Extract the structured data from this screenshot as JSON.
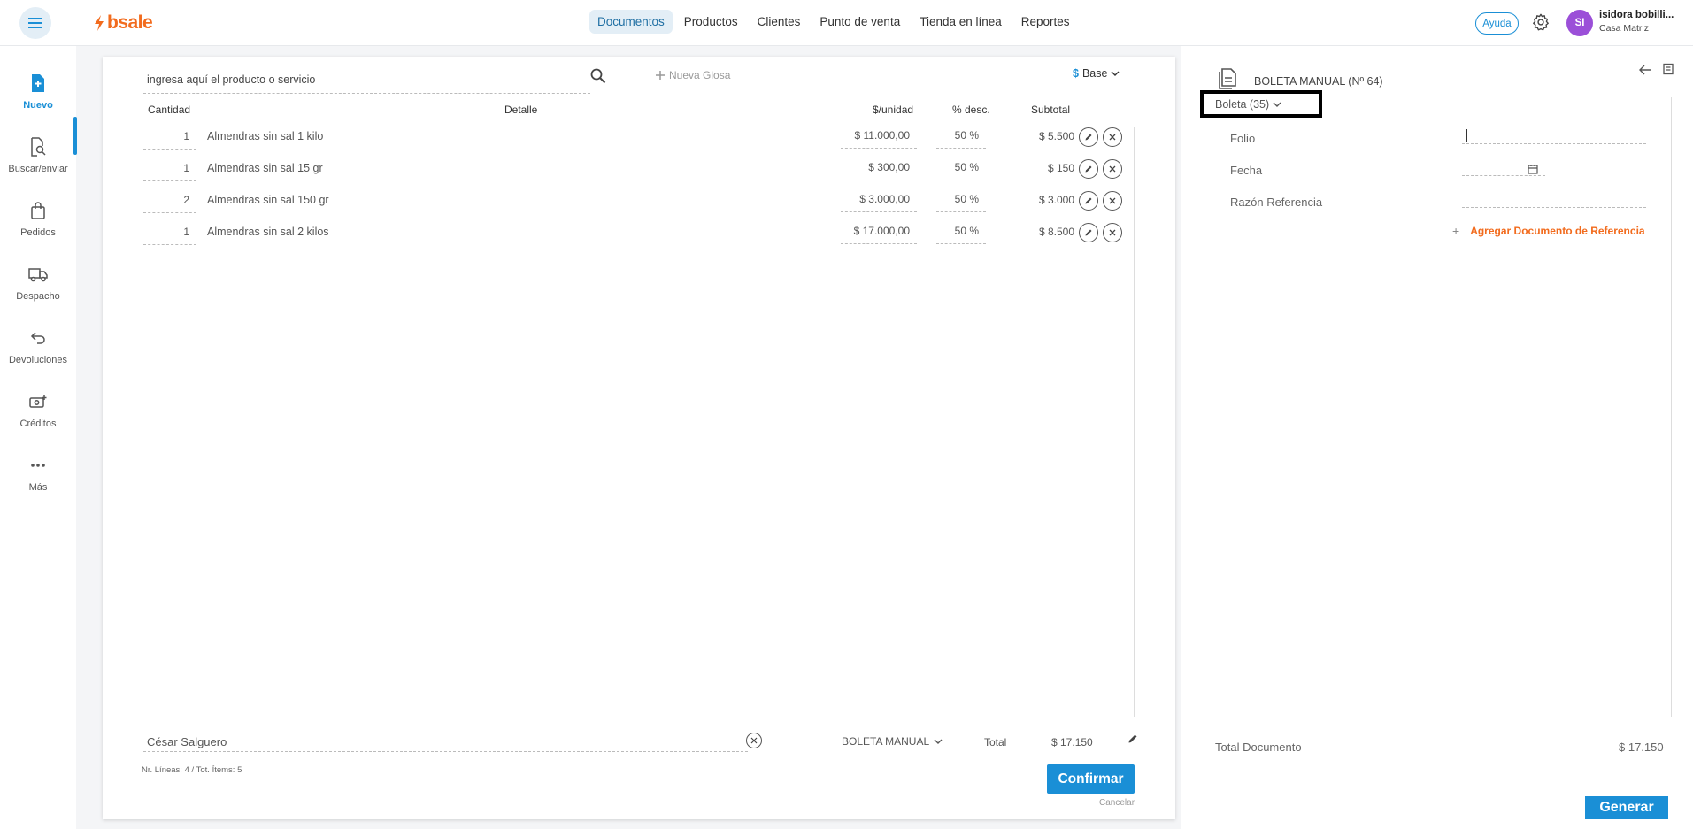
{
  "topbar": {
    "logo_text": "bsale",
    "nav": [
      "Documentos",
      "Productos",
      "Clientes",
      "Punto de venta",
      "Tienda en línea",
      "Reportes"
    ],
    "help_label": "Ayuda",
    "avatar_initials": "SI",
    "user_name": "isidora bobilli...",
    "user_store": "Casa Matriz",
    "accent_color": "#1a8fd6",
    "brand_color": "#f26b1d"
  },
  "sidebar": {
    "items": [
      {
        "label": "Nuevo",
        "icon": "new-document-icon"
      },
      {
        "label": "Buscar/enviar",
        "icon": "search-document-icon"
      },
      {
        "label": "Pedidos",
        "icon": "shopping-bag-icon"
      },
      {
        "label": "Despacho",
        "icon": "truck-icon"
      },
      {
        "label": "Devoluciones",
        "icon": "return-icon"
      },
      {
        "label": "Créditos",
        "icon": "credit-icon"
      },
      {
        "label": "Más",
        "icon": "more-icon"
      }
    ]
  },
  "editor": {
    "search_placeholder": "ingresa aquí el producto o servicio",
    "new_glosa_label": "Nueva Glosa",
    "currency_symbol": "$",
    "price_list": "Base",
    "headers": {
      "qty": "Cantidad",
      "detail": "Detalle",
      "unit_price": "$/unidad",
      "discount": "% desc.",
      "subtotal": "Subtotal"
    },
    "lines": [
      {
        "qty": "1",
        "detail": "Almendras sin sal 1 kilo",
        "price": "$ 11.000,00",
        "discount": "50 %",
        "subtotal": "$ 5.500"
      },
      {
        "qty": "1",
        "detail": "Almendras sin sal 15 gr",
        "price": "$ 300,00",
        "discount": "50 %",
        "subtotal": "$ 150"
      },
      {
        "qty": "2",
        "detail": "Almendras sin sal 150 gr",
        "price": "$ 3.000,00",
        "discount": "50 %",
        "subtotal": "$ 3.000"
      },
      {
        "qty": "1",
        "detail": "Almendras sin sal 2 kilos",
        "price": "$ 17.000,00",
        "discount": "50 %",
        "subtotal": "$ 8.500"
      }
    ],
    "client_value": "César Salguero",
    "doc_type": "BOLETA MANUAL",
    "total_label": "Total",
    "total_value": "$ 17.150",
    "lines_summary": "Nr. Líneas: 4 / Tot. Ítems: 5",
    "confirm_label": "Confirmar",
    "cancel_label": "Cancelar"
  },
  "right_panel": {
    "title": "BOLETA MANUAL (Nº 64)",
    "type_selector": "Boleta (35)",
    "folio_label": "Folio",
    "fecha_label": "Fecha",
    "razon_label": "Razón Referencia",
    "add_reference_label": "Agregar Documento de Referencia",
    "total_label": "Total Documento",
    "total_value": "$ 17.150",
    "generate_label": "Generar"
  }
}
